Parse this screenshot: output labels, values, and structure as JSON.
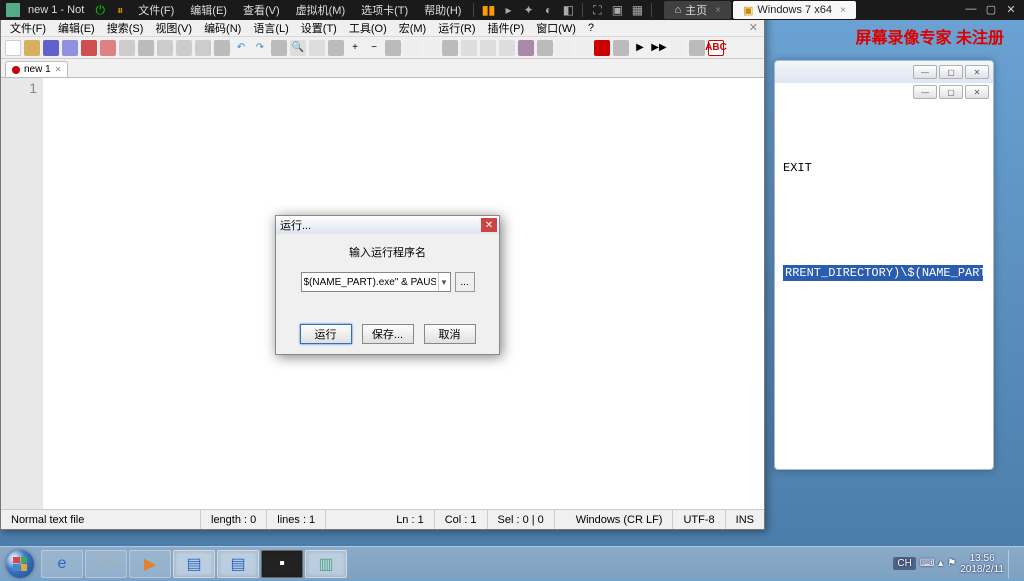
{
  "vm_bar": {
    "title": "new 1 - Not",
    "menus": [
      "文件(F)",
      "编辑(E)",
      "查看(V)",
      "虚拟机(M)",
      "选项卡(T)",
      "帮助(H)"
    ],
    "home_tab": "主页",
    "active_tab": "Windows 7 x64"
  },
  "watermark": "屏幕录像专家 未注册",
  "bg_window": {
    "exit_text": "EXIT",
    "highlight": "RRENT_DIRECTORY)\\$(NAME_PART).e"
  },
  "notepad": {
    "menu_items": [
      "文件(F)",
      "编辑(E)",
      "搜索(S)",
      "视图(V)",
      "编码(N)",
      "语言(L)",
      "设置(T)",
      "工具(O)",
      "宏(M)",
      "运行(R)",
      "插件(P)",
      "窗口(W)",
      "?"
    ],
    "tab_label": "new 1",
    "gutter_line": "1",
    "status": {
      "filetype": "Normal text file",
      "length": "length : 0",
      "lines": "lines : 1",
      "ln": "Ln : 1",
      "col": "Col : 1",
      "sel": "Sel : 0 | 0",
      "eol": "Windows (CR LF)",
      "enc": "UTF-8",
      "ins": "INS"
    }
  },
  "run_dialog": {
    "title": "运行...",
    "prompt": "输入运行程序名",
    "value": "$(NAME_PART).exe\" & PAUSE & EXIT",
    "browse": "...",
    "btn_run": "运行",
    "btn_save": "保存...",
    "btn_cancel": "取消"
  },
  "taskbar": {
    "ime": "CH",
    "time": "13:56",
    "date": "2018/2/11"
  }
}
